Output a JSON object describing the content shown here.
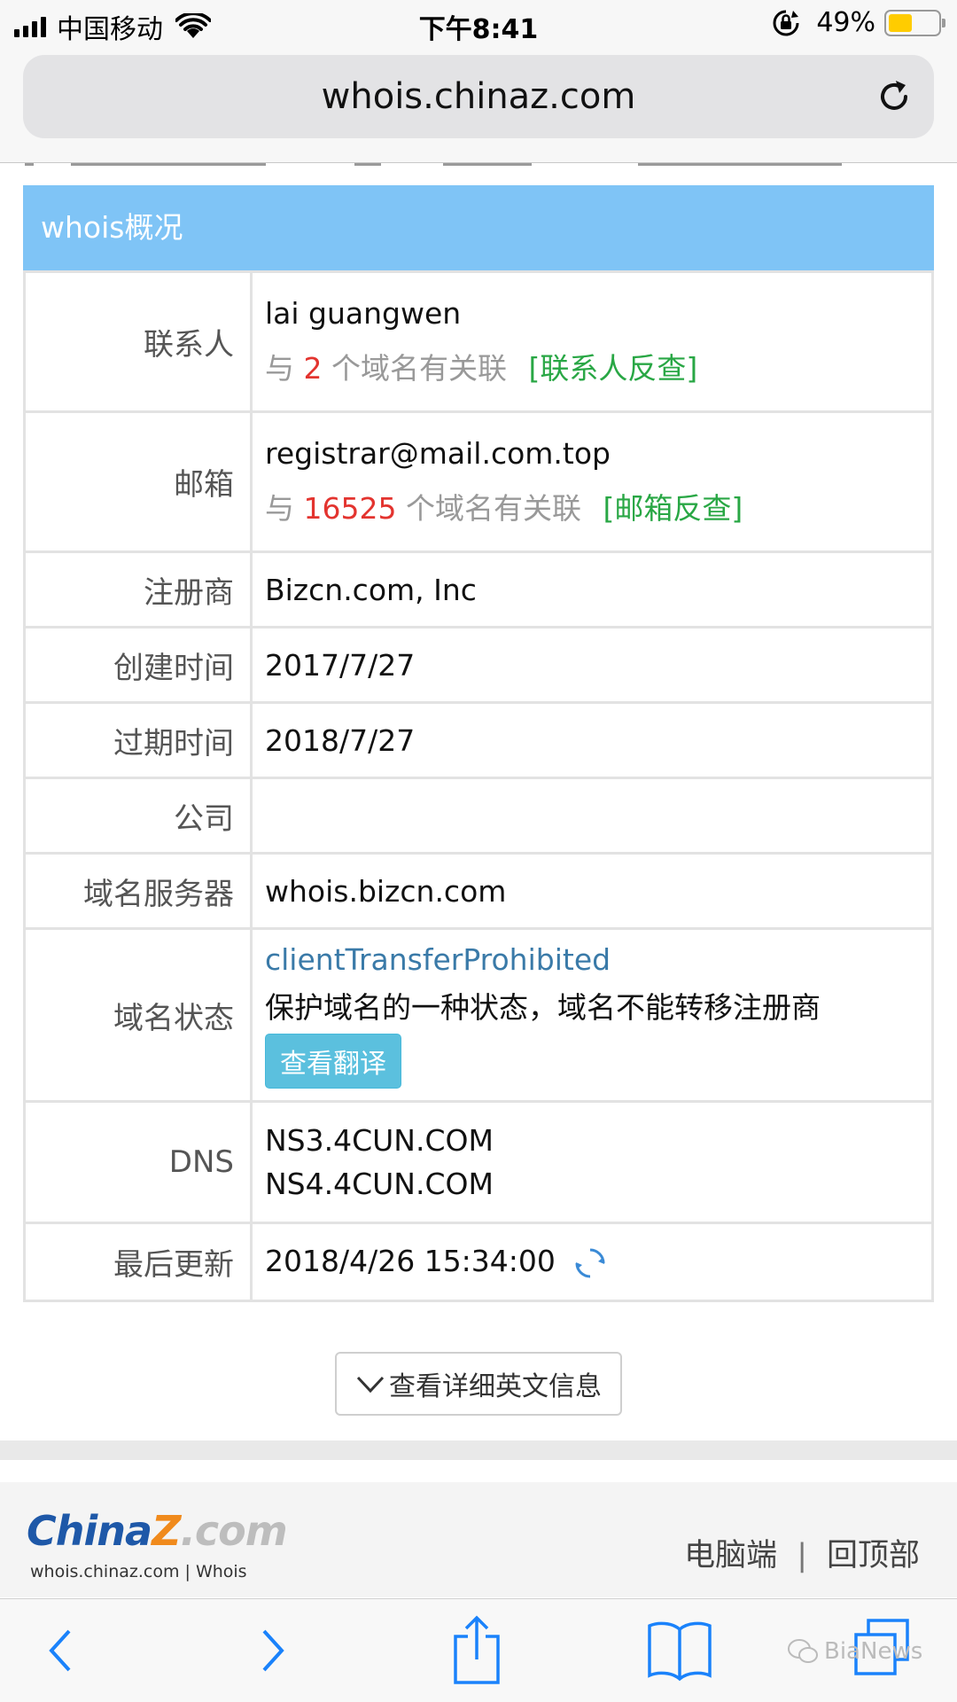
{
  "status_bar": {
    "carrier": "中国移动",
    "time": "下午8:41",
    "battery_percent": "49%",
    "battery_level": 0.49
  },
  "browser": {
    "url": "whois.chinaz.com"
  },
  "whois": {
    "header": "whois概况",
    "contact": {
      "label": "联系人",
      "value": "lai guangwen",
      "assoc_prefix": "与",
      "assoc_count": "2",
      "assoc_suffix": "个域名有关联",
      "lookup_link": "[联系人反查]"
    },
    "email": {
      "label": "邮箱",
      "value": "registrar@mail.com.top",
      "assoc_prefix": "与",
      "assoc_count": "16525",
      "assoc_suffix": "个域名有关联",
      "lookup_link": "[邮箱反查]"
    },
    "registrar": {
      "label": "注册商",
      "value": "Bizcn.com, Inc"
    },
    "created": {
      "label": "创建时间",
      "value": "2017/7/27"
    },
    "expires": {
      "label": "过期时间",
      "value": "2018/7/27"
    },
    "company": {
      "label": "公司",
      "value": ""
    },
    "whois_server": {
      "label": "域名服务器",
      "value": "whois.bizcn.com"
    },
    "domain_status": {
      "label": "域名状态",
      "status": "clientTransferProhibited",
      "description": "保护域名的一种状态，域名不能转移注册商",
      "translate_button": "查看翻译"
    },
    "dns": {
      "label": "DNS",
      "ns1": "NS3.4CUN.COM",
      "ns2": "NS4.4CUN.COM"
    },
    "last_update": {
      "label": "最后更新",
      "value": "2018/4/26 15:34:00"
    }
  },
  "more_button": "查看详细英文信息",
  "footer": {
    "logo_part1": "China",
    "logo_part2": "Z",
    "logo_part3": ".com",
    "logo_sub": "whois.chinaz.com | Whois",
    "desktop_link": "电脑端",
    "divider": "|",
    "top_link": "回顶部"
  },
  "watermark": "BiaNews",
  "colors": {
    "header_bg": "#7fc4f6",
    "count_red": "#e3342f",
    "link_green": "#29a745",
    "status_blue": "#3a7aa8",
    "button_cyan": "#5bc0de",
    "toolbar_blue": "#1a82fb"
  },
  "icons": [
    "signal-icon",
    "wifi-icon",
    "rotation-lock-icon",
    "battery-icon",
    "reload-icon",
    "refresh-spinner-icon",
    "chevron-down-icon",
    "back-icon",
    "forward-icon",
    "share-icon",
    "bookmarks-icon",
    "tabs-icon",
    "wechat-icon"
  ]
}
